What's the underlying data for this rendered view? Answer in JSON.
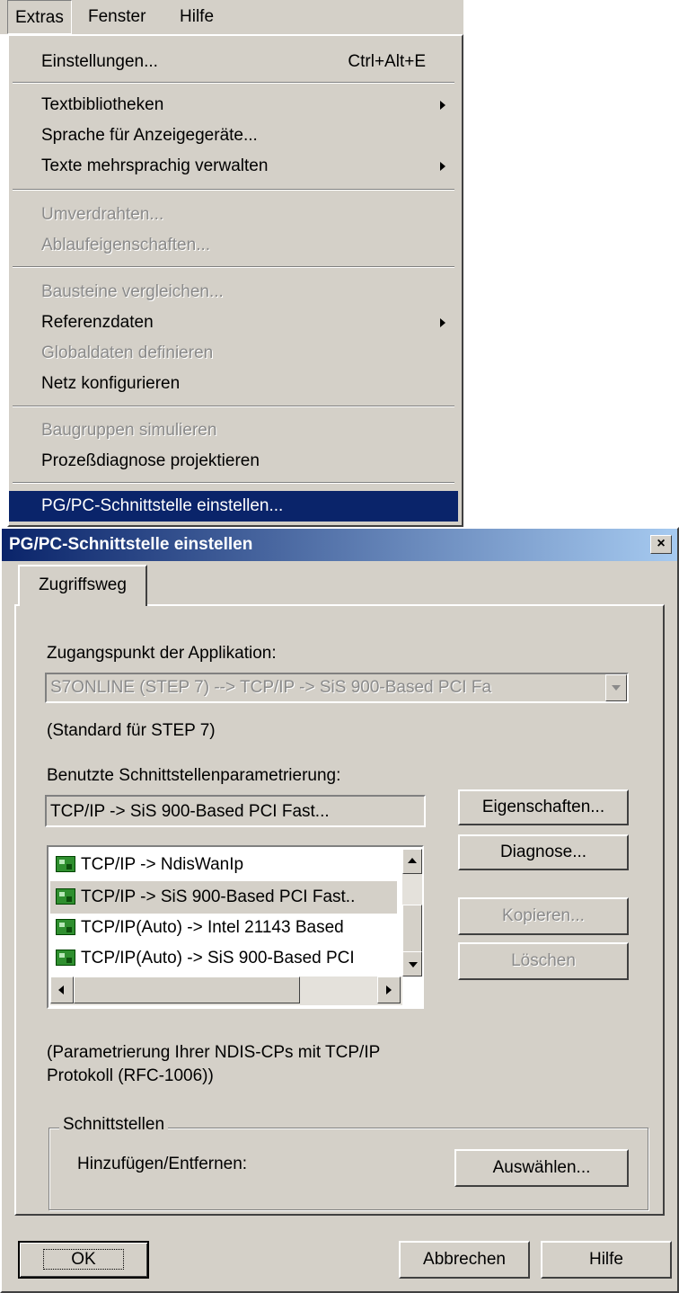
{
  "menubar": {
    "items": [
      "Extras",
      "Fenster",
      "Hilfe"
    ]
  },
  "menu": {
    "einstellungen": {
      "label": "Einstellungen...",
      "shortcut": "Ctrl+Alt+E"
    },
    "textbibliotheken": {
      "label": "Textbibliotheken"
    },
    "sprache": {
      "label": "Sprache für Anzeigegeräte..."
    },
    "texte": {
      "label": "Texte mehrsprachig verwalten"
    },
    "umverdrahten": {
      "label": "Umverdrahten..."
    },
    "ablauf": {
      "label": "Ablaufeigenschaften..."
    },
    "bausteine": {
      "label": "Bausteine vergleichen..."
    },
    "referenzdaten": {
      "label": "Referenzdaten"
    },
    "globaldaten": {
      "label": "Globaldaten definieren"
    },
    "netz": {
      "label": "Netz konfigurieren"
    },
    "baugruppen": {
      "label": "Baugruppen simulieren"
    },
    "prozess": {
      "label": "Prozeßdiagnose projektieren"
    },
    "pgpc": {
      "label": "PG/PC-Schnittstelle einstellen..."
    }
  },
  "dialog": {
    "title": "PG/PC-Schnittstelle einstellen",
    "close": "×",
    "tab_label": "Zugriffsweg",
    "access_point_label": "Zugangspunkt der Applikation:",
    "access_point_value": "S7ONLINE    (STEP 7)    --> TCP/IP -> SiS 900-Based PCI Fa",
    "standard_note": "(Standard für STEP 7)",
    "param_label": "Benutzte Schnittstellenparametrierung:",
    "param_value": "TCP/IP -> SiS 900-Based PCI Fast...",
    "list_items": [
      "TCP/IP -> NdisWanIp",
      "TCP/IP -> SiS 900-Based PCI Fast..",
      "TCP/IP(Auto) -> Intel 21143 Based",
      "TCP/IP(Auto) -> SiS 900-Based PCI"
    ],
    "buttons": {
      "eigenschaften": "Eigenschaften...",
      "diagnose": "Diagnose...",
      "kopieren": "Kopieren...",
      "loeschen": "Löschen",
      "auswaehlen": "Auswählen...",
      "ok": "OK",
      "abbrechen": "Abbrechen",
      "hilfe": "Hilfe"
    },
    "description": [
      "(Parametrierung Ihrer NDIS-CPs mit TCP/IP",
      "Protokoll (RFC-1006))"
    ],
    "group_title": "Schnittstellen",
    "add_remove_label": "Hinzufügen/Entfernen:"
  },
  "colors": {
    "face": "#d4d0c8",
    "highlight": "#0a246a",
    "disabled_text": "#8a8a8a"
  }
}
